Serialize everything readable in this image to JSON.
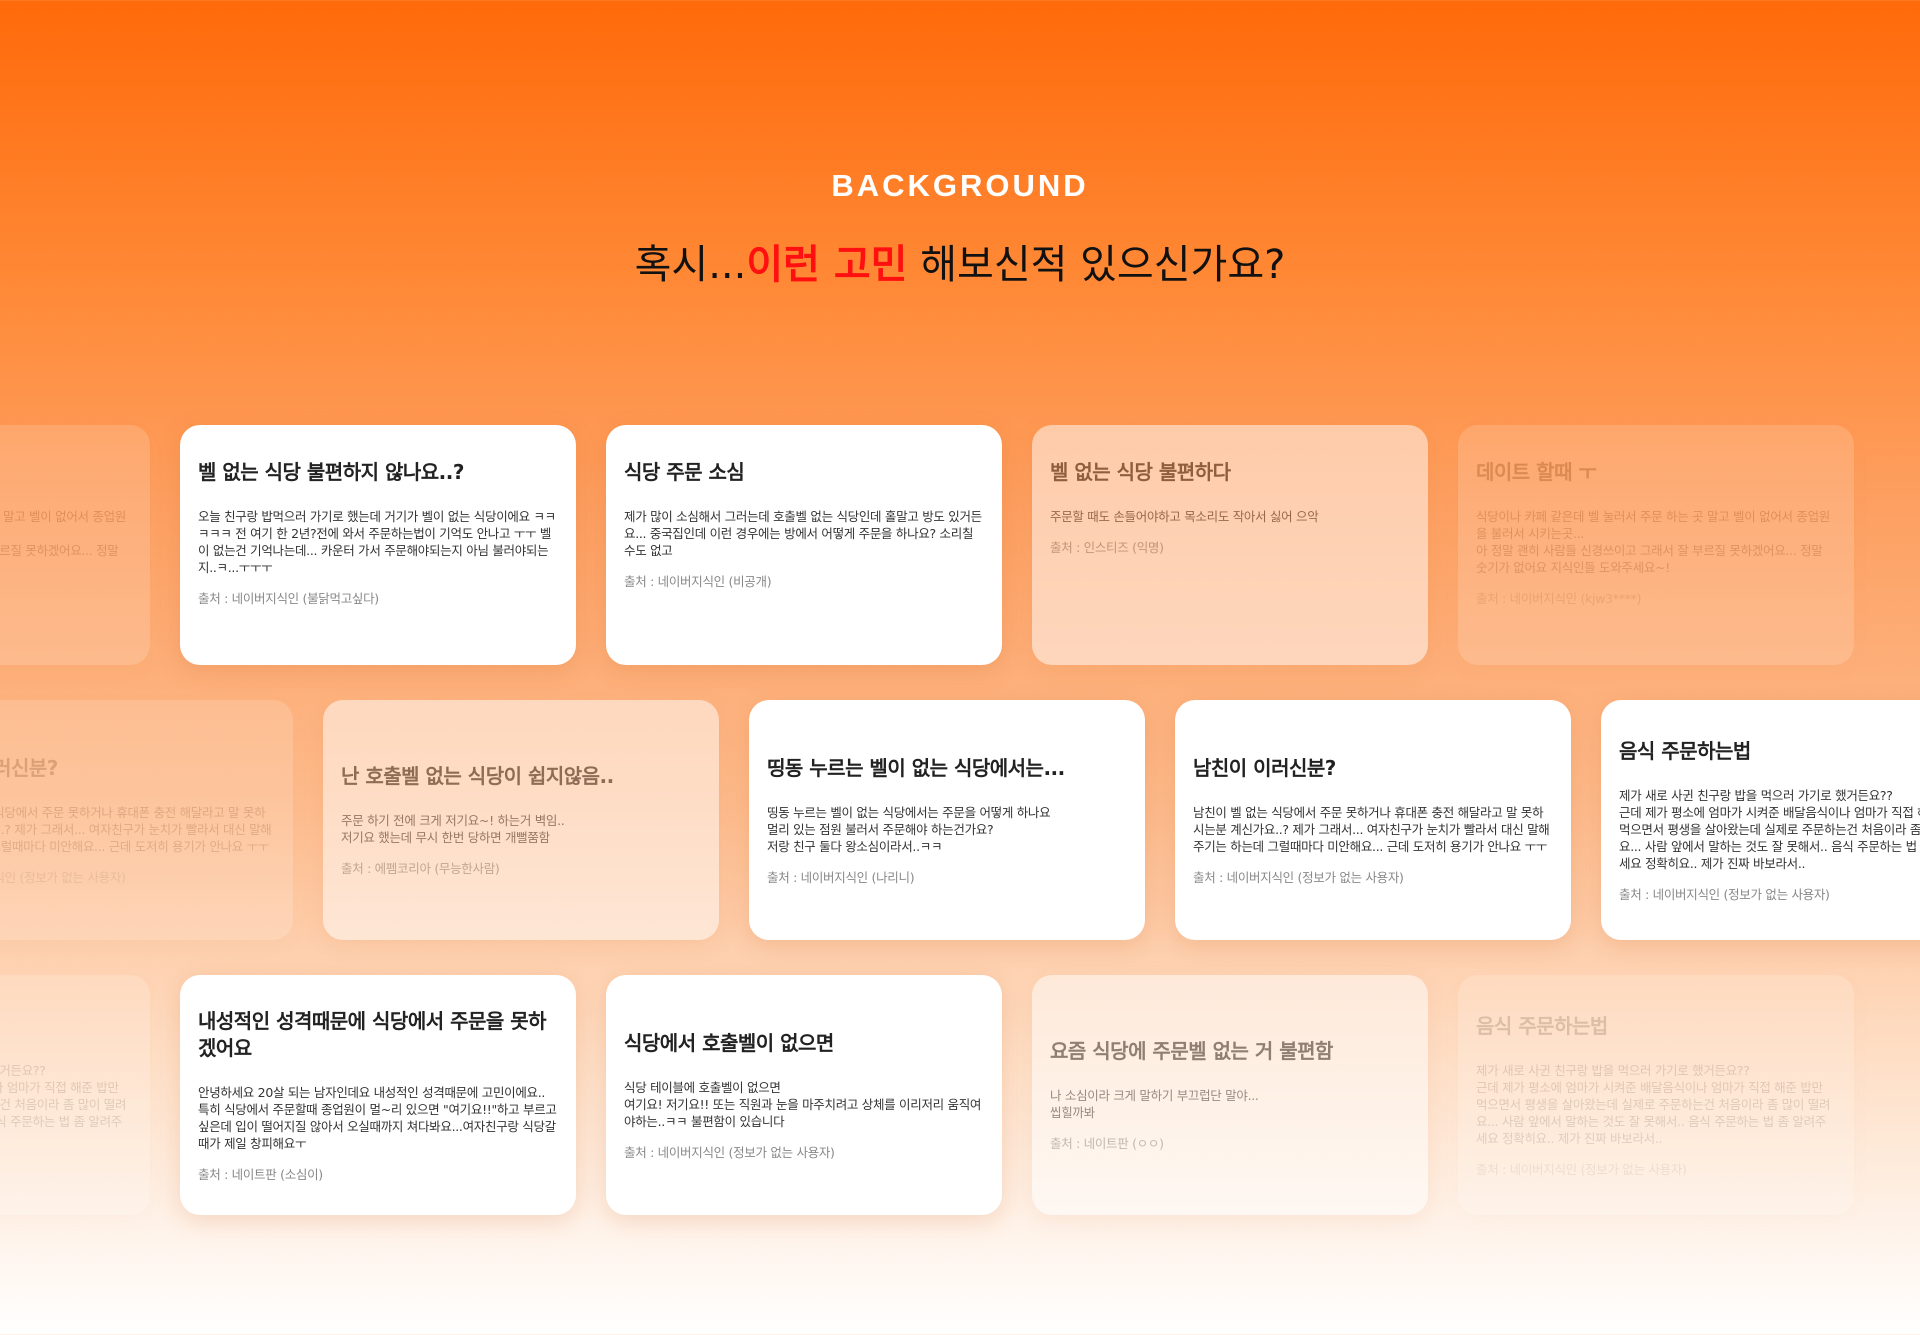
{
  "header": {
    "eyebrow": "BACKGROUND",
    "headline_prefix": "혹시...",
    "headline_highlight": "이런 고민",
    "headline_suffix": " 해보신적 있으신가요?",
    "highlight_color": "#ff0f0f"
  },
  "rows": [
    [
      {
        "title": "데이트 할때 ㅜ",
        "body": "식당이나 카페 같은데 벨 눌러서 주문 하는 곳 말고 벨이 없어서 종업원을 불러서 시키는곳...\n아 정말 괜히 사람들 신경쓰이고 그래서 잘 부르질 못하겠어요... 정말 숫기가 없어요 지식인들 도와주세요~!",
        "source": "출처 : 네이버지식인 (kjw3****)"
      },
      {
        "title": "벨 없는 식당 불편하지 않나요..?",
        "body": "오늘 친구랑 밥먹으러 가기로 했는데 거기가 벨이 없는 식당이에요 ㅋㅋㅋㅋㅋ 전 여기 한 2년?전에 와서 주문하는법이 기억도 안나고 ㅜㅜ 벨이 없는건 기억나는데... 카운터 가서 주문해야되는지 아님 불러야되는지..ㅋ...ㅜㅜㅜ",
        "source": "출처 : 네이버지식인 (불닭먹고싶다)"
      },
      {
        "title": "식당 주문 소심",
        "body": "제가 많이 소심해서 그러는데 호출벨 없는 식당인데 홀말고 방도 있거든요... 중국집인데 이런 경우에는 방에서 어떻게 주문을 하나요? 소리칠 수도 없고",
        "source": "출처 : 네이버지식인 (비공개)"
      },
      {
        "title": "벨 없는 식당 불편하다",
        "body": "주문할 때도 손들어야하고 목소리도 작아서 싫어 으악",
        "source": "출처 : 인스티즈 (익명)"
      },
      {
        "title": "데이트 할때 ㅜ",
        "body": "식당이나 카페 같은데 벨 눌러서 주문 하는 곳 말고 벨이 없어서 종업원을 불러서 시키는곳...\n아 정말 괜히 사람들 신경쓰이고 그래서 잘 부르질 못하겠어요... 정말 숫기가 없어요 지식인들 도와주세요~!",
        "source": "출처 : 네이버지식인 (kjw3****)"
      }
    ],
    [
      {
        "title": "남친이 이러신분?",
        "body": "남친이 벨 없는 식당에서 주문 못하거나 휴대폰 충전 해달라고 말 못하시는분 계신가요..? 제가 그래서... 여자친구가 눈치가 빨라서 대신 말해주기는 하는데 그럴때마다 미안해요... 근데 도저히 용기가 안나요 ㅜㅜ",
        "source": "출처 : 네이버지식인 (정보가 없는 사용자)"
      },
      {
        "title": "난 호출벨 없는 식당이 쉽지않음..",
        "body": "주문 하기 전에 크게 저기요~! 하는거 벽임..\n저기요 했는데 무시 한번 당하면 개뻘쭘함",
        "source": "출처 : 에펨코리아 (무능한사람)"
      },
      {
        "title": "띵동 누르는 벨이 없는 식당에서는...",
        "body": "띵동 누르는 벨이 없는 식당에서는 주문을 어떻게 하나요\n멀리 있는 점원 불러서 주문해야 하는건가요?\n저랑 친구 둘다 왕소심이라서..ㅋㅋ",
        "source": "출처 : 네이버지식인 (나리니)"
      },
      {
        "title": "남친이 이러신분?",
        "body": "남친이 벨 없는 식당에서 주문 못하거나 휴대폰 충전 해달라고 말 못하시는분 계신가요..? 제가 그래서... 여자친구가 눈치가 빨라서 대신 말해주기는 하는데 그럴때마다 미안해요... 근데 도저히 용기가 안나요 ㅜㅜ",
        "source": "출처 : 네이버지식인 (정보가 없는 사용자)"
      },
      {
        "title": "음식 주문하는법",
        "body": "제가 새로 사귄 친구랑 밥을 먹으러 가기로 했거든요??\n근데 제가 평소에 엄마가 시켜준 배달음식이나 엄마가 직접 해준 밥만 먹으면서 평생을 살아왔는데 실제로 주문하는건 처음이라 좀 많이 떨려요... 사람 앞에서 말하는 것도 잘 못해서.. 음식 주문하는 법 좀 알려주세요 정확히요.. 제가 진짜 바보라서..",
        "source": "출처 : 네이버지식인 (정보가 없는 사용자)"
      }
    ],
    [
      {
        "title": "음식 주문하는법",
        "body": "제가 새로 사귄 친구랑 밥을 먹으러 가기로 했거든요??\n근데 제가 평소에 엄마가 시켜준 배달음식이나 엄마가 직접 해준 밥만 먹으면서 평생을 살아왔는데 실제로 주문하는건 처음이라 좀 많이 떨려요... 사람 앞에서 말하는 것도 잘 못해서.. 음식 주문하는 법 좀 알려주세요 정확히요.. 제가 진짜 바보라서..",
        "source": "출처 : 네이버지식인 (정보가 없는 사용자)"
      },
      {
        "title": "내성적인 성격때문에 식당에서 주문을 못하겠어요",
        "body": "안녕하세요 20살 되는 남자인데요 내성적인 성격때문에 고민이에요.. 특히 식당에서 주문할때 종업원이 멀~리 있으면 \"여기요!!\"하고 부르고싶은데 입이 떨어지질 않아서 오실때까지 쳐다봐요...여자친구랑 식당갈때가 제일 창피해요ㅜ",
        "source": "출처 : 네이트판 (소심이)"
      },
      {
        "title": "식당에서 호출벨이 없으면",
        "body": "식당 테이블에 호출벨이 없으면\n여기요! 저기요!! 또는 직원과 눈을 마주치려고 상체를 이리저리 움직여야하는..ㅋㅋ 불편함이 있습니다",
        "source": "출처 : 네이버지식인 (정보가 없는 사용자)"
      },
      {
        "title": "요즘 식당에 주문벨 없는 거 불편함",
        "body": "나 소심이라 크게 말하기 부끄럽단 말야...\n씹힐까봐",
        "source": "출처 : 네이트판 (ㅇㅇ)"
      },
      {
        "title": "음식 주문하는법",
        "body": "제가 새로 사귄 친구랑 밥을 먹으러 가기로 했거든요??\n근데 제가 평소에 엄마가 시켜준 배달음식이나 엄마가 직접 해준 밥만 먹으면서 평생을 살아왔는데 실제로 주문하는건 처음이라 좀 많이 떨려요... 사람 앞에서 말하는 것도 잘 못해서.. 음식 주문하는 법 좀 알려주세요 정확히요.. 제가 진짜 바보라서..",
        "source": "출처 : 네이버지식인 (정보가 없는 사용자)"
      }
    ]
  ]
}
